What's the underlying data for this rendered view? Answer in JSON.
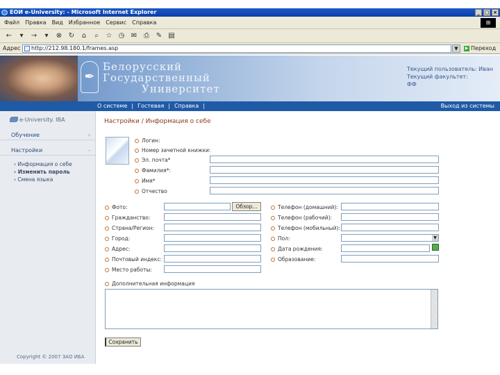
{
  "window": {
    "title": "ЕОИ e-University: - Microsoft Internet Explorer",
    "controls": [
      "_",
      "□",
      "×"
    ]
  },
  "menu": [
    "Файл",
    "Правка",
    "Вид",
    "Избранное",
    "Сервис",
    "Справка"
  ],
  "address": {
    "label": "Адрес",
    "url": "http://212.98.180.1/frames.asp",
    "go": "Переход"
  },
  "header": {
    "uni_line1": "Белорусский",
    "uni_line2": "Государственный",
    "uni_line3": "Университет",
    "current_user": "Текущий пользователь: Иван",
    "current_faculty": "Текущий факультет:",
    "faculty": "ФФ"
  },
  "nav": {
    "about": "О системе",
    "guest": "Гостевая",
    "help": "Справка",
    "logout": "Выход из системы"
  },
  "sidebar": {
    "brand": "e-University. IBA",
    "sections": [
      {
        "label": "Обучение"
      },
      {
        "label": "Настройки"
      }
    ],
    "subitems": [
      "Информация о себе",
      "Изменить пароль",
      "Смена языка"
    ],
    "copyright": "Copyright © 2007 ЗАО ИБА"
  },
  "main": {
    "title": "Настройки / Информация о себе",
    "top_fields": [
      "Логин:",
      "Номер зачетной книжки:",
      "Эл. почта*",
      "Фамилия*:",
      "Имя*",
      "Отчество"
    ],
    "left_fields": [
      "Фото:",
      "Гражданство:",
      "Страна/Регион:",
      "Город:",
      "Адрес:",
      "Почтовый индекс:",
      "Место работы:"
    ],
    "right_fields": [
      "Телефон (домашний):",
      "Телефон (рабочий):",
      "Телефон (мобильный):",
      "Пол:",
      "Дата рождения:",
      "Образование:"
    ],
    "browse": "Обзор...",
    "additional": "Дополнительная информация",
    "save": "Сохранить"
  }
}
